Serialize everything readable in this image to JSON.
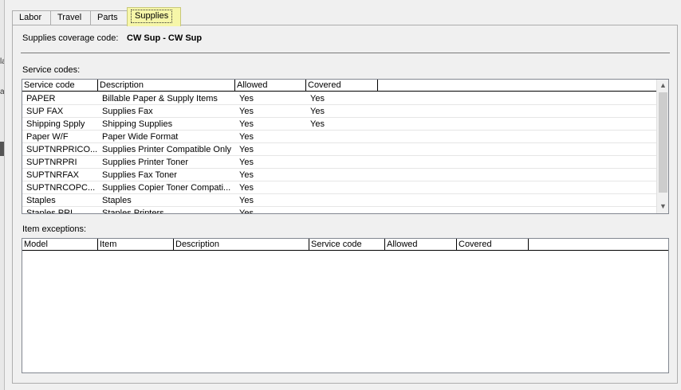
{
  "left_strip": {
    "fragments": [
      "la",
      "a"
    ]
  },
  "tabs": [
    {
      "label": "Labor",
      "active": false
    },
    {
      "label": "Travel",
      "active": false
    },
    {
      "label": "Parts",
      "active": false
    },
    {
      "label": "Supplies",
      "active": true
    }
  ],
  "coverage": {
    "label": "Supplies coverage code:",
    "value": "CW Sup - CW Sup"
  },
  "service_codes": {
    "label": "Service codes:",
    "columns": [
      "Service code",
      "Description",
      "Allowed",
      "Covered"
    ],
    "rows": [
      {
        "code": "PAPER",
        "description": "Billable Paper & Supply Items",
        "allowed": "Yes",
        "covered": "Yes"
      },
      {
        "code": "SUP FAX",
        "description": "Supplies Fax",
        "allowed": "Yes",
        "covered": "Yes"
      },
      {
        "code": "Shipping Spply",
        "description": "Shipping Supplies",
        "allowed": "Yes",
        "covered": "Yes"
      },
      {
        "code": "Paper W/F",
        "description": "Paper Wide Format",
        "allowed": "Yes",
        "covered": ""
      },
      {
        "code": "SUPTNRPRICO...",
        "description": "Supplies Printer Compatible Only",
        "allowed": "Yes",
        "covered": ""
      },
      {
        "code": "SUPTNRPRI",
        "description": "Supplies Printer Toner",
        "allowed": "Yes",
        "covered": ""
      },
      {
        "code": "SUPTNRFAX",
        "description": "Supplies Fax Toner",
        "allowed": "Yes",
        "covered": ""
      },
      {
        "code": "SUPTNRCOPC...",
        "description": "Supplies Copier Toner Compati...",
        "allowed": "Yes",
        "covered": ""
      },
      {
        "code": "Staples",
        "description": "Staples",
        "allowed": "Yes",
        "covered": ""
      },
      {
        "code": "Staples PRI",
        "description": "Staples Printers",
        "allowed": "Yes",
        "covered": ""
      }
    ]
  },
  "item_exceptions": {
    "label": "Item exceptions:",
    "columns": [
      "Model",
      "Item",
      "Description",
      "Service code",
      "Allowed",
      "Covered"
    ]
  },
  "icons": {
    "scroll_up": "chevron-up-icon",
    "scroll_down": "chevron-down-icon"
  },
  "colors": {
    "active_tab_bg": "#f6f6a8",
    "grid_border": "#828790"
  }
}
